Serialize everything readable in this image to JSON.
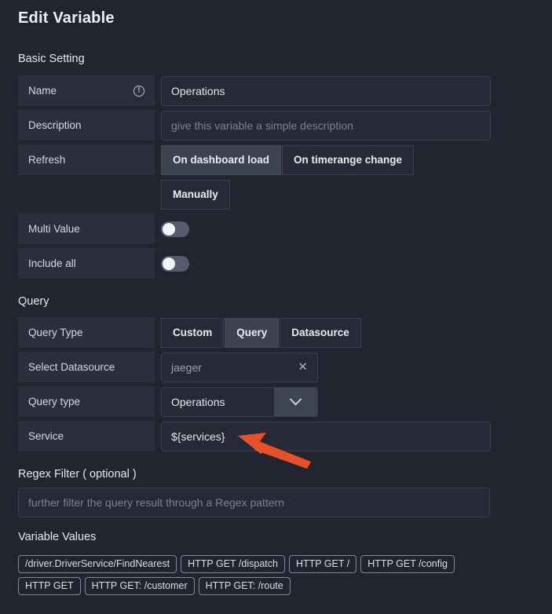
{
  "page": {
    "title": "Edit Variable",
    "background": "#22252f"
  },
  "sections": {
    "basic_setting": "Basic Setting",
    "query": "Query",
    "regex_filter": "Regex Filter ( optional )",
    "variable_values": "Variable Values"
  },
  "basic": {
    "name": {
      "label": "Name",
      "info_icon": "info-icon",
      "value": "Operations"
    },
    "description": {
      "label": "Description",
      "value": "",
      "placeholder": "give this variable a simple description"
    },
    "refresh": {
      "label": "Refresh",
      "options": [
        {
          "label": "On dashboard load",
          "selected": true
        },
        {
          "label": "On timerange change",
          "selected": false
        },
        {
          "label": "Manually",
          "selected": false
        }
      ]
    },
    "multi_value": {
      "label": "Multi Value",
      "on": false
    },
    "include_all": {
      "label": "Include all",
      "on": false
    }
  },
  "query": {
    "query_type": {
      "label": "Query Type",
      "options": [
        {
          "label": "Custom",
          "selected": false
        },
        {
          "label": "Query",
          "selected": true
        },
        {
          "label": "Datasource",
          "selected": false
        }
      ]
    },
    "select_datasource": {
      "label": "Select Datasource",
      "value": "jaeger",
      "clear_icon": "close-icon"
    },
    "query_type_dropdown": {
      "label": "Query type",
      "value": "Operations",
      "chevron_icon": "chevron-down-icon"
    },
    "service": {
      "label": "Service",
      "value": "${services}"
    }
  },
  "regex": {
    "value": "",
    "placeholder": "further filter the query result through a Regex pattern"
  },
  "variable_values": [
    "/driver.DriverService/FindNearest",
    "HTTP GET /dispatch",
    "HTTP GET /",
    "HTTP GET /config",
    "HTTP GET",
    "HTTP GET: /customer",
    "HTTP GET: /route"
  ],
  "annotation": {
    "arrow_color": "#e8502a",
    "points_at": "service-input"
  }
}
